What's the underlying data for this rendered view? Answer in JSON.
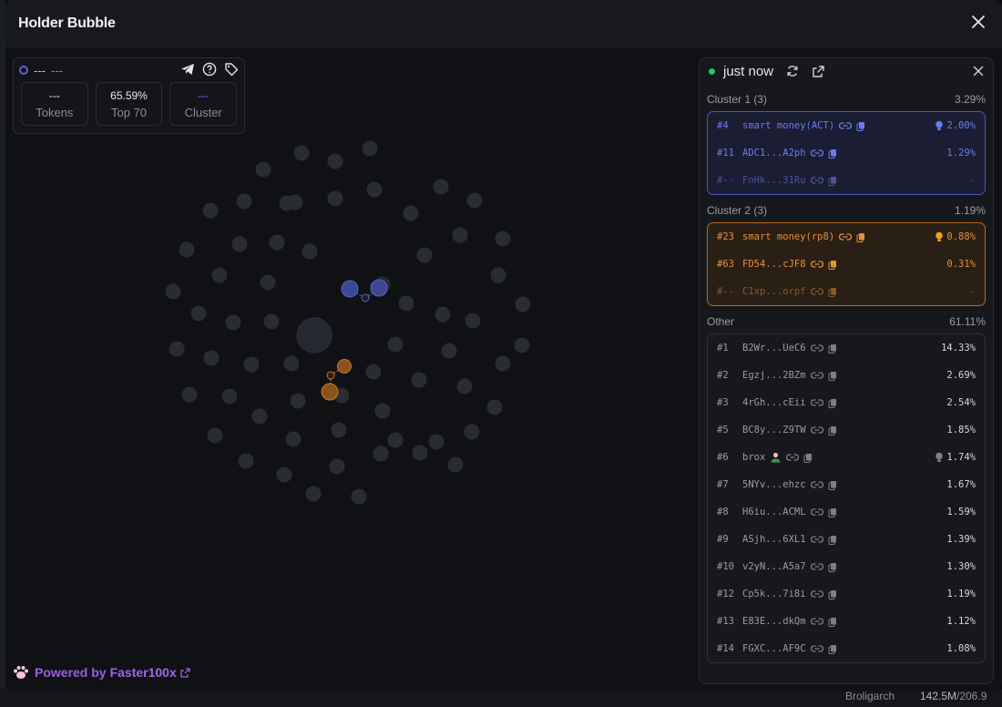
{
  "modal": {
    "title": "Holder Bubble"
  },
  "stats": {
    "header_dash1": "---",
    "header_dash2": "---",
    "boxes": [
      {
        "value": "---",
        "label": "Tokens"
      },
      {
        "value": "65.59%",
        "label": "Top 70"
      },
      {
        "value": "---",
        "label": "Cluster"
      }
    ]
  },
  "panel": {
    "time": "just now",
    "cluster1": {
      "title": "Cluster 1 (3)",
      "pct": "3.29%",
      "rows": [
        {
          "rank": "#4",
          "name": "smart money(ACT)",
          "pct": "2.00%",
          "bulb": true
        },
        {
          "rank": "#11",
          "name": "ADC1...A2ph",
          "pct": "1.29%",
          "bulb": false
        },
        {
          "rank": "#--",
          "name": "FnHk...31Ru",
          "pct": "-",
          "bulb": false
        }
      ]
    },
    "cluster2": {
      "title": "Cluster 2 (3)",
      "pct": "1.19%",
      "rows": [
        {
          "rank": "#23",
          "name": "smart money(rp8)",
          "pct": "0.88%",
          "bulb": true
        },
        {
          "rank": "#63",
          "name": "FD54...cJF8",
          "pct": "0.31%",
          "bulb": false
        },
        {
          "rank": "#--",
          "name": "C1xp...orpf",
          "pct": "-",
          "bulb": false
        }
      ]
    },
    "other": {
      "title": "Other",
      "pct": "61.11%",
      "rows": [
        {
          "rank": "#1",
          "name": "B2Wr...UeC6",
          "pct": "14.33%"
        },
        {
          "rank": "#2",
          "name": "Egzj...2BZm",
          "pct": "2.69%"
        },
        {
          "rank": "#3",
          "name": "4rGh...cEii",
          "pct": "2.54%"
        },
        {
          "rank": "#5",
          "name": "BC8y...Z9TW",
          "pct": "1.85%"
        },
        {
          "rank": "#6",
          "name": "brox",
          "pct": "1.74%"
        },
        {
          "rank": "#7",
          "name": "5NYv...ehzc",
          "pct": "1.67%"
        },
        {
          "rank": "#8",
          "name": "H6iu...ACML",
          "pct": "1.59%"
        },
        {
          "rank": "#9",
          "name": "ASjh...6XL1",
          "pct": "1.39%"
        },
        {
          "rank": "#10",
          "name": "v2yN...A5a7",
          "pct": "1.30%"
        },
        {
          "rank": "#12",
          "name": "Cp5k...7i8i",
          "pct": "1.19%"
        },
        {
          "rank": "#13",
          "name": "E83E...dkQm",
          "pct": "1.12%"
        },
        {
          "rank": "#14",
          "name": "FGXC...AF9C",
          "pct": "1.08%"
        }
      ]
    }
  },
  "footer": {
    "powered": "Powered by",
    "brand": "Faster100x"
  },
  "backdrop": {
    "name": "Broligarch",
    "value": "142.5M",
    "value2": "/206.9"
  },
  "colors": {
    "cluster1": "#5a64c8",
    "cluster2": "#c7782a",
    "bubble": "#2a2c33"
  }
}
